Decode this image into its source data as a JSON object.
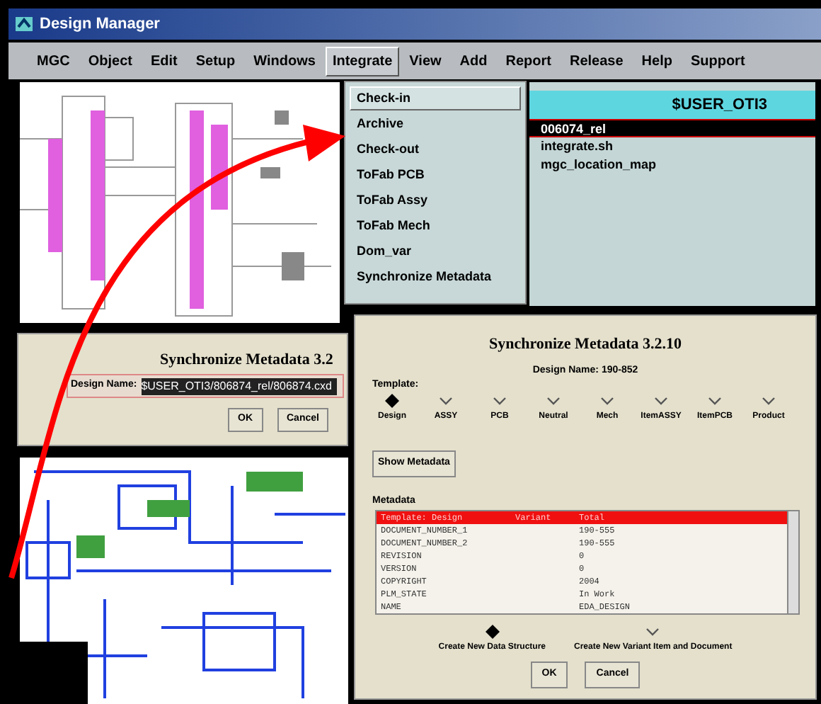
{
  "window": {
    "title": "Design Manager"
  },
  "menu": [
    {
      "label": "MGC",
      "selected": false
    },
    {
      "label": "Object",
      "selected": false
    },
    {
      "label": "Edit",
      "selected": false
    },
    {
      "label": "Setup",
      "selected": false
    },
    {
      "label": "Windows",
      "selected": false
    },
    {
      "label": "Integrate",
      "selected": true
    },
    {
      "label": "View",
      "selected": false
    },
    {
      "label": "Add",
      "selected": false
    },
    {
      "label": "Report",
      "selected": false
    },
    {
      "label": "Release",
      "selected": false
    },
    {
      "label": "Help",
      "selected": false
    },
    {
      "label": "Support",
      "selected": false
    }
  ],
  "dropdown": [
    {
      "label": "Check-in",
      "selected": true
    },
    {
      "label": "Archive",
      "selected": false
    },
    {
      "label": "Check-out",
      "selected": false
    },
    {
      "label": "ToFab PCB",
      "selected": false
    },
    {
      "label": "ToFab Assy",
      "selected": false
    },
    {
      "label": "ToFab Mech",
      "selected": false
    },
    {
      "label": "Dom_var",
      "selected": false
    },
    {
      "label": "Synchronize Metadata",
      "selected": false
    }
  ],
  "file_list": {
    "header": "$USER_OTI3",
    "items": [
      {
        "label": "006074_rel",
        "selected": true
      },
      {
        "label": "integrate.sh",
        "selected": false
      },
      {
        "label": "mgc_location_map",
        "selected": false
      }
    ]
  },
  "small_dialog": {
    "title": "Synchronize Metadata 3.2",
    "field_label": "Design Name:",
    "field_value": "$USER_OTI3/806874_rel/806874.cxd",
    "buttons": [
      "OK",
      "Cancel"
    ]
  },
  "sync_dialog": {
    "title": "Synchronize Metadata 3.2.10",
    "design_name": "Design Name: 190-852",
    "template_label": "Template:",
    "templates": [
      {
        "label": "Design",
        "selected": true
      },
      {
        "label": "ASSY",
        "selected": false
      },
      {
        "label": "PCB",
        "selected": false
      },
      {
        "label": "Neutral",
        "selected": false
      },
      {
        "label": "Mech",
        "selected": false
      },
      {
        "label": "ItemASSY",
        "selected": false
      },
      {
        "label": "ItemPCB",
        "selected": false
      },
      {
        "label": "Product",
        "selected": false
      }
    ],
    "show_button": "Show Metadata",
    "metadata_label": "Metadata",
    "rows": [
      {
        "cells": [
          "Template: Design",
          "Variant",
          "Total"
        ],
        "selected": true
      },
      {
        "cells": [
          "DOCUMENT_NUMBER_1",
          "190-555"
        ],
        "selected": false
      },
      {
        "cells": [
          "DOCUMENT_NUMBER_2",
          "190-555"
        ],
        "selected": false
      },
      {
        "cells": [
          "REVISION",
          "0"
        ],
        "selected": false
      },
      {
        "cells": [
          "VERSION",
          "0"
        ],
        "selected": false
      },
      {
        "cells": [
          "COPYRIGHT",
          "2004"
        ],
        "selected": false
      },
      {
        "cells": [
          "PLM_STATE",
          "In Work"
        ],
        "selected": false
      },
      {
        "cells": [
          "NAME",
          "EDA_DESIGN"
        ],
        "selected": false
      }
    ],
    "modes": [
      {
        "label": "Create New Data Structure",
        "selected": true
      },
      {
        "label": "Create New Variant Item and Document",
        "selected": false
      }
    ],
    "buttons": [
      "OK",
      "Cancel"
    ]
  }
}
